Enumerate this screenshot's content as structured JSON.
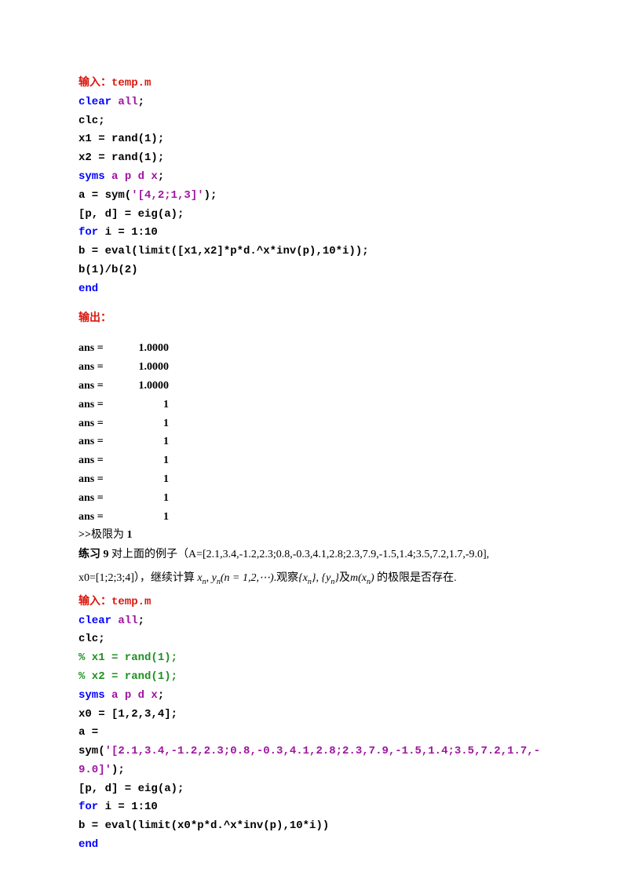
{
  "header1": {
    "label": "输入：",
    "file": "temp.m"
  },
  "code1": {
    "l1a": "clear ",
    "l1b": "all",
    "l1c": ";",
    "l2": "clc;",
    "l3": "x1 = rand(1);",
    "l4": "x2 = rand(1);",
    "l5a": "syms ",
    "l5b": "a p d x",
    "l5c": ";",
    "l6a": "a = sym(",
    "l6b": "'[4,2;1,3]'",
    "l6c": ");",
    "l7": "[p, d] = eig(a);",
    "l8a": "for ",
    "l8b": "i = 1:10",
    "l9": "b = eval(limit([x1,x2]*p*d.^x*inv(p),10*i));",
    "l10": "b(1)/b(2)",
    "l11": "end"
  },
  "output_label": "输出：",
  "ans": [
    {
      "label": "ans =",
      "val": "1.0000"
    },
    {
      "label": "ans =",
      "val": "1.0000"
    },
    {
      "label": "ans =",
      "val": "1.0000"
    },
    {
      "label": "ans =",
      "val": "1"
    },
    {
      "label": "ans =",
      "val": "1"
    },
    {
      "label": "ans =",
      "val": "1"
    },
    {
      "label": "ans =",
      "val": "1"
    },
    {
      "label": "ans =",
      "val": "1"
    },
    {
      "label": "ans =",
      "val": "1"
    },
    {
      "label": "ans =",
      "val": "1"
    }
  ],
  "limit_line_prefix": ">>",
  "limit_line_text": "极限为",
  "limit_line_val": "1",
  "exercise": {
    "label": "练习 9",
    "text1": "   对上面的例子（A=[2.1,3.4,-1.2,2.3;0.8,-0.3,4.1,2.8;2.3,7.9,-1.5,1.4;3.5,7.2,1.7,-9.0],",
    "text2a": "x0=[1;2;3;4]），继续计算",
    "xn": "x",
    "yn": "y",
    "sub_n": "n",
    "paren": "(n = 1,2,⋯)",
    "observe": ".观察",
    "brace_x": "{x",
    "close_b": "}",
    "comma": ", ",
    "brace_y": "{y",
    "and": "及",
    "mfunc": "m(x",
    "paren_c": ") ",
    "tail": "的极限是否存在."
  },
  "header2": {
    "label": "输入：",
    "file": "temp.m"
  },
  "code2": {
    "l1a": "clear ",
    "l1b": "all",
    "l1c": ";",
    "l2": "clc;",
    "l3": "% x1 = rand(1);",
    "l4": "% x2 = rand(1);",
    "l5a": "syms ",
    "l5b": "a p d x",
    "l5c": ";",
    "l6": "x0 = [1,2,3,4];",
    "l7": "a =",
    "l8a": "sym(",
    "l8b": "'[2.1,3.4,-1.2,2.3;0.8,-0.3,4.1,2.8;2.3,7.9,-1.5,1.4;3.5,7.2,1.7,-9.0]'",
    "l8c": ");",
    "l9": "[p, d] = eig(a);",
    "l10a": "for ",
    "l10b": "i = 1:10",
    "l11": "b = eval(limit(x0*p*d.^x*inv(p),10*i))",
    "l12": "end"
  }
}
